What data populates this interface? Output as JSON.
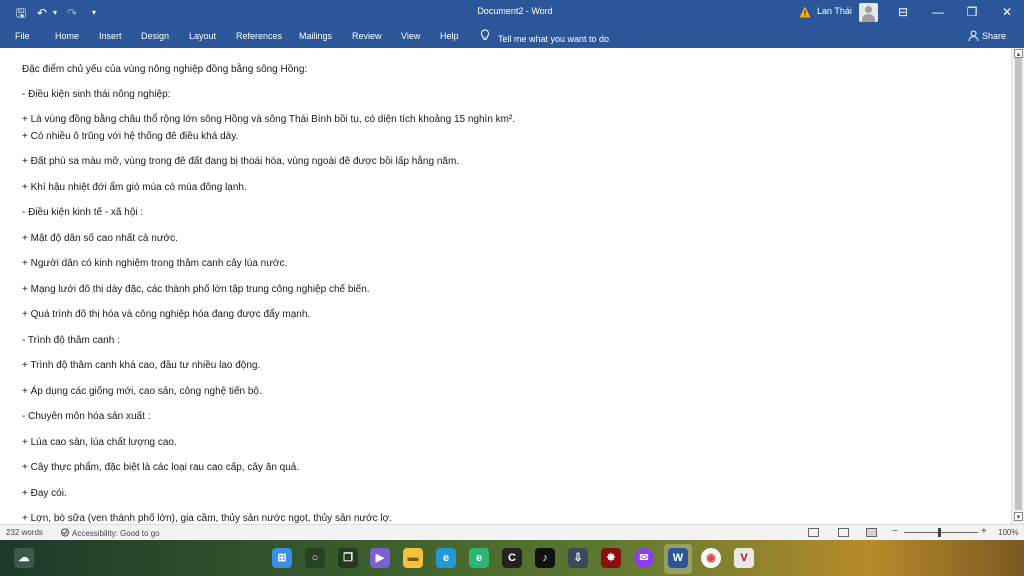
{
  "titlebar": {
    "doc_title": "Document2 - Word",
    "user_name": "Lan Thái",
    "icons": [
      "save-icon",
      "undo-icon",
      "redo-icon",
      "customize-icon",
      "warning-icon",
      "ribbon-display-icon",
      "minimize-icon",
      "restore-icon",
      "close-icon"
    ],
    "glyphs": {
      "save": "🖫",
      "undo": "↶",
      "undo_drop": "▾",
      "redo": "↷",
      "customize": "▾",
      "ribbon": "⊟",
      "minimize": "—",
      "restore": "❐",
      "close": "✕"
    }
  },
  "ribbon": {
    "tabs": [
      "File",
      "Home",
      "Insert",
      "Design",
      "Layout",
      "References",
      "Mailings",
      "Review",
      "View",
      "Help"
    ],
    "tell_me": "Tell me what you want to do",
    "share": "Share"
  },
  "document": {
    "lines": [
      "Đặc điểm chủ yếu của vùng nông nghiệp đồng bằng sông Hồng:",
      "- Điều kiện sinh thái nông nghiệp:",
      "+ Là vùng đồng bằng châu thổ rộng lớn sông Hồng và sông Thái Bình bồi tụ, có diện tích khoảng 15 nghìn km².",
      "+ Có nhiều ô trũng với hệ thống đê điều khá dày.",
      "+ Đất phù sa màu mỡ, vùng trong đê đất đang bị thoái hóa, vùng ngoài đê được bồi lấp hằng năm.",
      "+ Khí hậu nhiệt đới ẩm gió mùa có mùa đông lạnh.",
      "- Điều kiện kinh tế - xã hội :",
      "+ Mật độ dân số cao nhất cả nước.",
      "+ Người dân có kinh nghiệm trong thâm canh cây lúa nước.",
      "+ Mạng lưới đô thị dày đặc, các thành phố lớn tập trung công nghiệp chế biến.",
      "+ Quá trình đô thị hóa và công nghiệp hóa đang được đẩy mạnh.",
      "- Trình độ thâm canh :",
      "+ Trình độ thâm canh khá cao, đầu tư nhiều lao động.",
      "+ Áp dụng các giống mới, cao sản, công nghệ tiến bộ.",
      "- Chuyên môn hóa sản xuất :",
      "+ Lúa cao sản, lúa chất lượng cao.",
      "+ Cây thực phẩm, đặc biệt là các loại rau cao cấp, cây ăn quả.",
      "+ Đay cói.",
      "+ Lợn, bò sữa (ven thành phố lớn), gia cầm, thủy sản nước ngọt, thủy sản nước lợ."
    ]
  },
  "status": {
    "words": "232 words",
    "accessibility": "Accessibility: Good to go",
    "zoom": "100%",
    "zoom_minus": "−",
    "zoom_plus": "+"
  },
  "taskbar": {
    "icons": [
      "weather-icon",
      "start-icon",
      "search-icon",
      "task-view-icon",
      "video-call-icon",
      "file-explorer-icon",
      "edge-icon",
      "edge-alt-icon",
      "browser-icon",
      "tiktok-icon",
      "app-icon",
      "shield-app-icon",
      "messenger-icon",
      "word-icon",
      "chrome-icon",
      "unikey-icon"
    ]
  },
  "colors": {
    "word_blue": "#2b579a",
    "status_bg": "#f3f3f3"
  }
}
